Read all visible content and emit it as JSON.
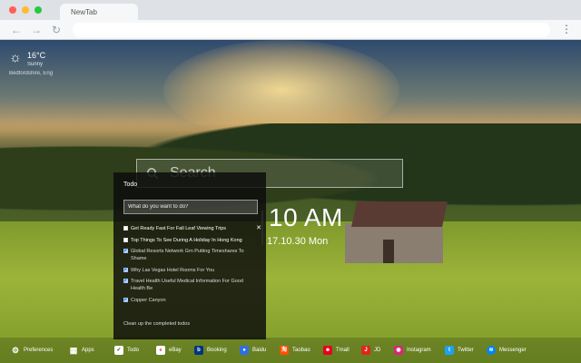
{
  "browser": {
    "tab_title": "NewTab",
    "back_icon": "arrow-left-icon",
    "forward_icon": "arrow-right-icon",
    "reload_icon": "reload-icon",
    "menu_icon": "more-vert-icon"
  },
  "weather": {
    "icon": "sun-icon",
    "temperature": "16°C",
    "condition": "Sunny",
    "location": "Bedfordshire, Eng"
  },
  "search": {
    "placeholder": "Search"
  },
  "clock": {
    "time": "10 AM",
    "date": "17.10.30 Mon"
  },
  "todo": {
    "title": "Todo",
    "input_placeholder": "What do you want to do?",
    "items": [
      {
        "text": "Get Ready Fast For Fall Leaf Viewing Trips",
        "checked": false
      },
      {
        "text": "Top Things To See During A Holiday In Hong Kong",
        "checked": false
      },
      {
        "text": "Global Resorts Network Grn Putting Timeshares To Shame",
        "checked": true
      },
      {
        "text": "Why Las Vegas Hotel Rooms For You",
        "checked": true
      },
      {
        "text": "Travel Health Useful Medical Information For Good Health Be",
        "checked": true
      },
      {
        "text": "Copper Canyon",
        "checked": true
      }
    ],
    "delete_icon": "close-icon",
    "clear_label": "Clean up the completed todos"
  },
  "dock": {
    "items": [
      {
        "label": "Preferences",
        "icon": "gear-icon",
        "color": "#555555"
      },
      {
        "label": "Apps",
        "icon": "apps-grid-icon",
        "color": "#3b5998"
      },
      {
        "label": "Todo",
        "icon": "checkbox-icon",
        "color": "#ffffff"
      },
      {
        "label": "eBay",
        "icon": "ebay-icon",
        "color": "#ffffff"
      },
      {
        "label": "Booking",
        "icon": "booking-icon",
        "color": "#003580"
      },
      {
        "label": "Baidu",
        "icon": "baidu-icon",
        "color": "#2f6fe4"
      },
      {
        "label": "Taobao",
        "icon": "taobao-icon",
        "color": "#ff5000"
      },
      {
        "label": "Tmall",
        "icon": "tmall-icon",
        "color": "#e8001c"
      },
      {
        "label": "JD",
        "icon": "jd-icon",
        "color": "#e1251b"
      },
      {
        "label": "Instagram",
        "icon": "instagram-icon",
        "color": "#d62976"
      },
      {
        "label": "Twitter",
        "icon": "twitter-icon",
        "color": "#1da1f2"
      },
      {
        "label": "Messenger",
        "icon": "messenger-icon",
        "color": "#0084ff"
      }
    ]
  }
}
